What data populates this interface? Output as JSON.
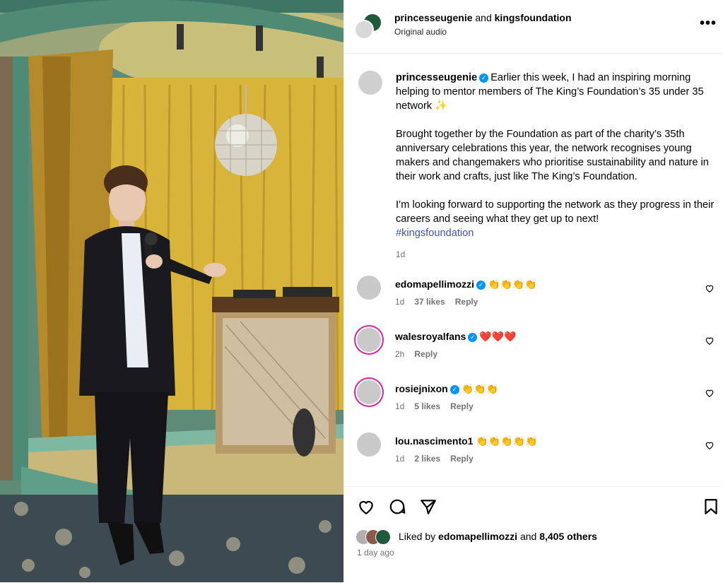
{
  "header": {
    "user1": "princesseugenie",
    "connector": "and",
    "user2": "kingsfoundation",
    "audio": "Original audio",
    "more_icon": "more-horizontal-icon"
  },
  "caption": {
    "username": "princesseugenie",
    "para1": "Earlier this week, I had an inspiring morning helping to mentor members of The King’s Foundation’s 35 under 35 network ✨",
    "para2": "Brought together by the Foundation as part of the charity’s 35th anniversary celebrations this year, the network recognises young makers and changemakers who prioritise sustainability and nature in their work and crafts, just like The King’s Foundation.",
    "para3": "I’m looking forward to supporting the network as they progress in their careers and seeing what they get up to next!",
    "hashtag": "#kingsfoundation",
    "time": "1d"
  },
  "comments": [
    {
      "username": "edomapellimozzi",
      "text": "👏👏👏👏",
      "time": "1d",
      "likes": "37 likes",
      "reply": "Reply"
    },
    {
      "username": "walesroyalfans",
      "text": "❤️❤️❤️",
      "time": "2h",
      "likes": "",
      "reply": "Reply"
    },
    {
      "username": "rosiejnixon",
      "text": "👏👏👏",
      "time": "1d",
      "likes": "5 likes",
      "reply": "Reply"
    },
    {
      "username": "lou.nascimento1",
      "text": "👏👏👏👏👏",
      "time": "1d",
      "likes": "2 likes",
      "reply": "Reply"
    }
  ],
  "footer": {
    "liked_prefix": "Liked by",
    "liked_user": "edomapellimozzi",
    "liked_and": "and",
    "liked_others": "8,405 others",
    "posted": "1 day ago"
  },
  "colors": {
    "verified": "#0095f6",
    "hashtag": "#4050c0",
    "story_ring": "#d6249f"
  }
}
